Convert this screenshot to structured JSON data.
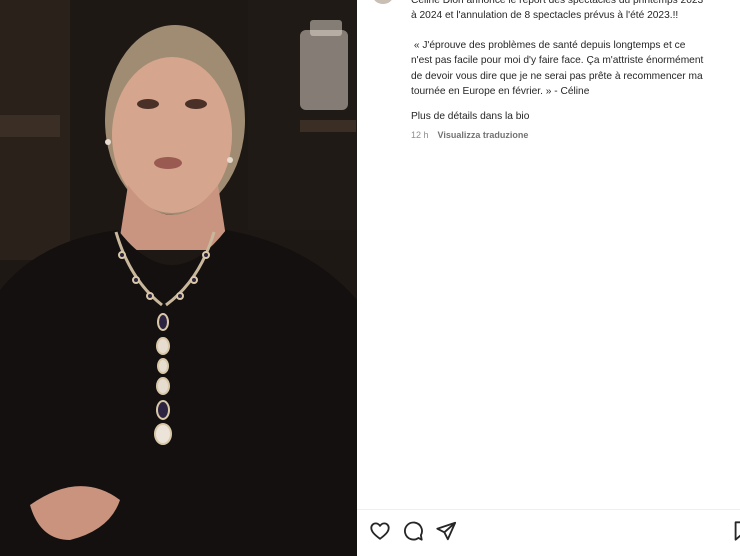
{
  "post": {
    "caption_head": "Céline Dion annonce le report des spectacles du printemps 2023\nà 2024 et l'annulation de 8 spectacles prévus à l'été 2023.!!",
    "caption_quote": " « J'éprouve des problèmes de santé depuis longtemps et ce\nn'est pas facile pour moi d'y faire face. Ça m'attriste énormément\nde devoir vous dire que je ne serai pas prête à recommencer ma\ntournée en Europe en février. » - Céline",
    "caption_more": "Plus de détails dans la bio",
    "time_ago": "12 h",
    "translate_label": "Visualizza traduzione"
  },
  "icons": {
    "like": "heart-icon",
    "comment": "comment-icon",
    "share": "paper-plane-icon",
    "save": "bookmark-icon"
  },
  "colors": {
    "text": "#262626",
    "secondary": "#8e8e8e",
    "media_bg": "#1b1613"
  }
}
